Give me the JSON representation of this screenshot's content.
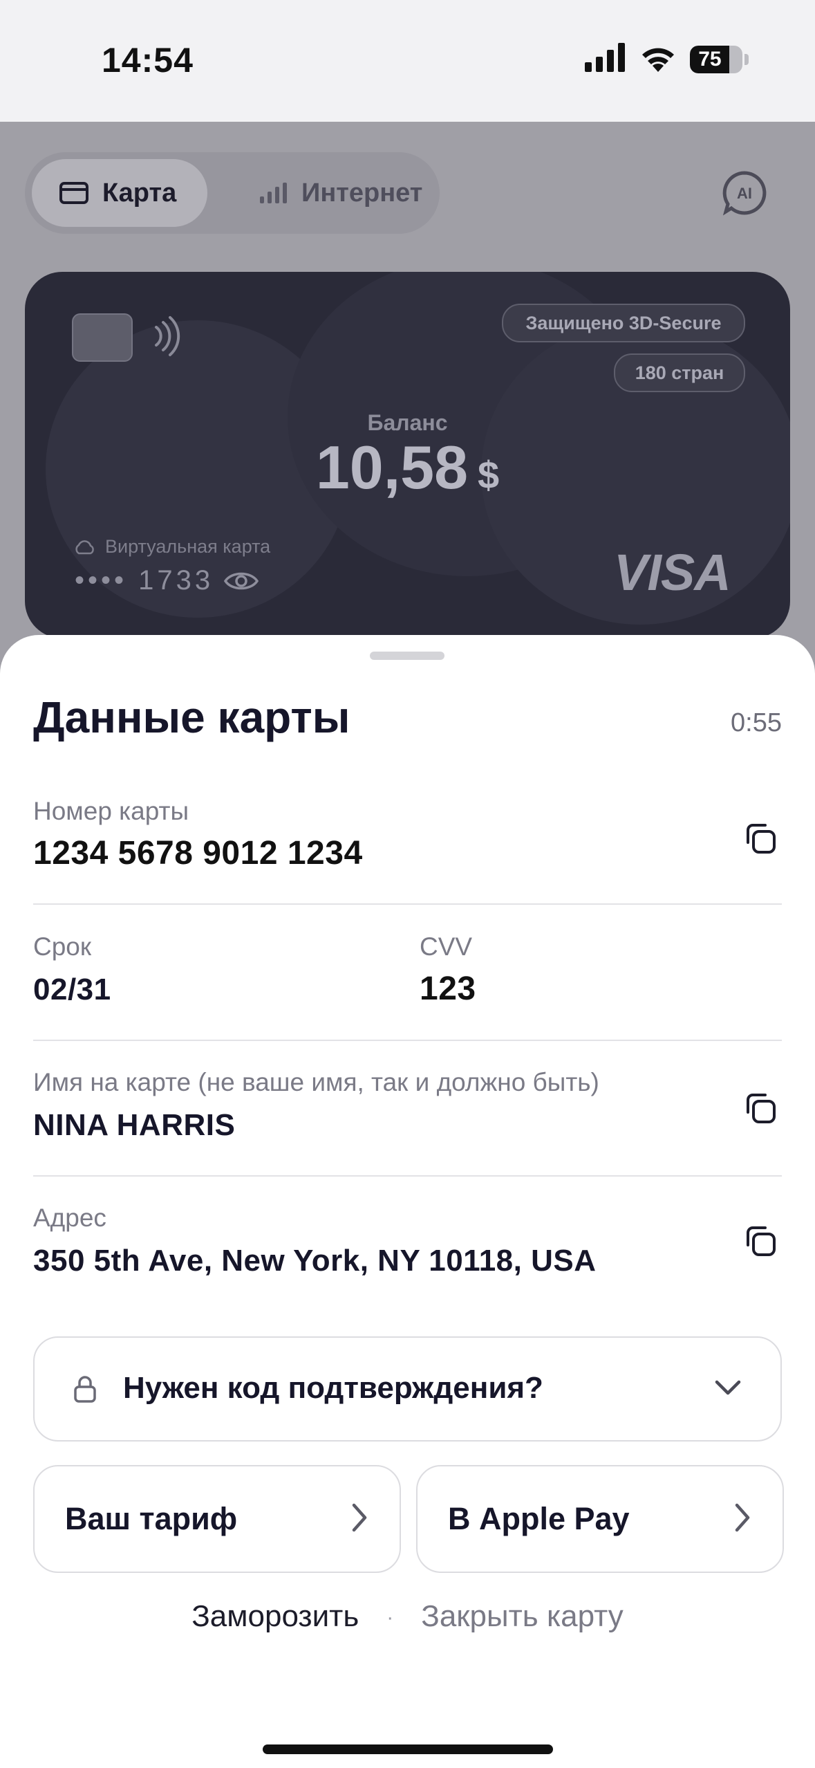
{
  "status_bar": {
    "time": "14:54",
    "battery": "75",
    "battery_level": 0.75
  },
  "tabs": [
    {
      "label": "Карта",
      "icon": "card-icon",
      "active": true
    },
    {
      "label": "Интернет",
      "icon": "signal-icon",
      "active": false
    }
  ],
  "ai_button": {
    "label": "AI",
    "icon": "ai-chat-icon"
  },
  "card": {
    "badges": [
      "Защищено 3D-Secure",
      "180 стран"
    ],
    "balance_label": "Баланс",
    "balance_amount": "10,58",
    "balance_currency": "$",
    "type_label": "Виртуальная карта",
    "masked_number": "•••• 1733",
    "brand": "VISA"
  },
  "sheet": {
    "title": "Данные карты",
    "timer": "0:55",
    "card_number_label": "Номер карты",
    "card_number": "1234 5678 9012 1234",
    "expiry_label": "Срок",
    "expiry": "02/31",
    "cvv_label": "CVV",
    "cvv": "123",
    "name_label": "Имя на карте (не ваше имя, так и должно быть)",
    "name": "NINA HARRIS",
    "address_label": "Адрес",
    "address": "350 5th Ave, New York, NY 10118, USA",
    "confirm_code": "Нужен код подтверждения?",
    "tariff_button": "Ваш тариф",
    "apple_pay_button": "В Apple Pay",
    "freeze_link": "Заморозить",
    "separator": "·",
    "close_link": "Закрыть карту"
  },
  "colors": {
    "overlay": "#a09fa6",
    "card_bg": "#2a2a38",
    "sheet_bg": "#ffffff",
    "text_primary": "#16162a",
    "text_secondary": "#7a7a86"
  }
}
